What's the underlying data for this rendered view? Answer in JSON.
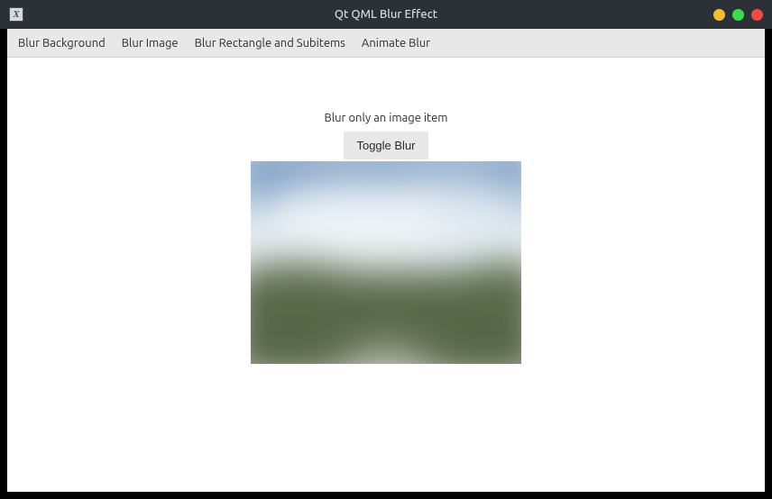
{
  "window": {
    "title": "Qt QML Blur Effect",
    "sys_icon_glyph": "X"
  },
  "tabs": {
    "blur_background": "Blur Background",
    "blur_image": "Blur Image",
    "blur_rect": "Blur Rectangle and Subitems",
    "animate_blur": "Animate Blur"
  },
  "page": {
    "heading": "Blur only an image item",
    "toggle_label": "Toggle Blur"
  },
  "colors": {
    "titlebar": "#2c3138",
    "tabbar": "#e8e8e8",
    "text": "#2b2b2b",
    "ctrl_min": "#f5be32",
    "ctrl_max": "#3bdb52",
    "ctrl_close": "#ed4b44"
  }
}
